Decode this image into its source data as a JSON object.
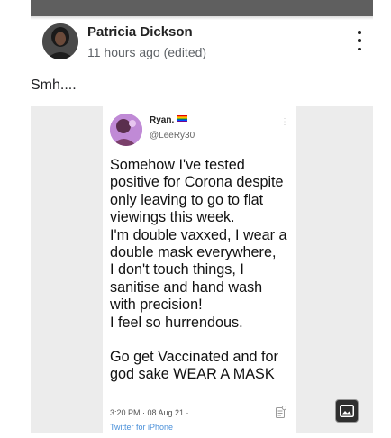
{
  "post": {
    "author": "Patricia Dickson",
    "timestamp": "11 hours ago (edited)",
    "text": "Smh...."
  },
  "tweet": {
    "name": "Ryan.",
    "handle": "@LeeRy30",
    "more": "⋮",
    "lines": [
      "Somehow I've tested",
      "positive for Corona despite",
      "only leaving to go to flat",
      "viewings this week.",
      "I'm double vaxxed, I wear a",
      "double mask everywhere,",
      "I don't touch things, I",
      "sanitise and hand wash",
      "with precision!",
      "I feel so hurrendous.",
      "",
      "Go get Vaccinated and for",
      "god sake WEAR A MASK"
    ],
    "meta": "3:20 PM · 08 Aug 21 ·",
    "meta_cut": "Twitter for iPhone"
  },
  "icons": {
    "more": "more-vert-icon",
    "view_image": "image-icon",
    "stats": "tweet-analytics-icon"
  }
}
